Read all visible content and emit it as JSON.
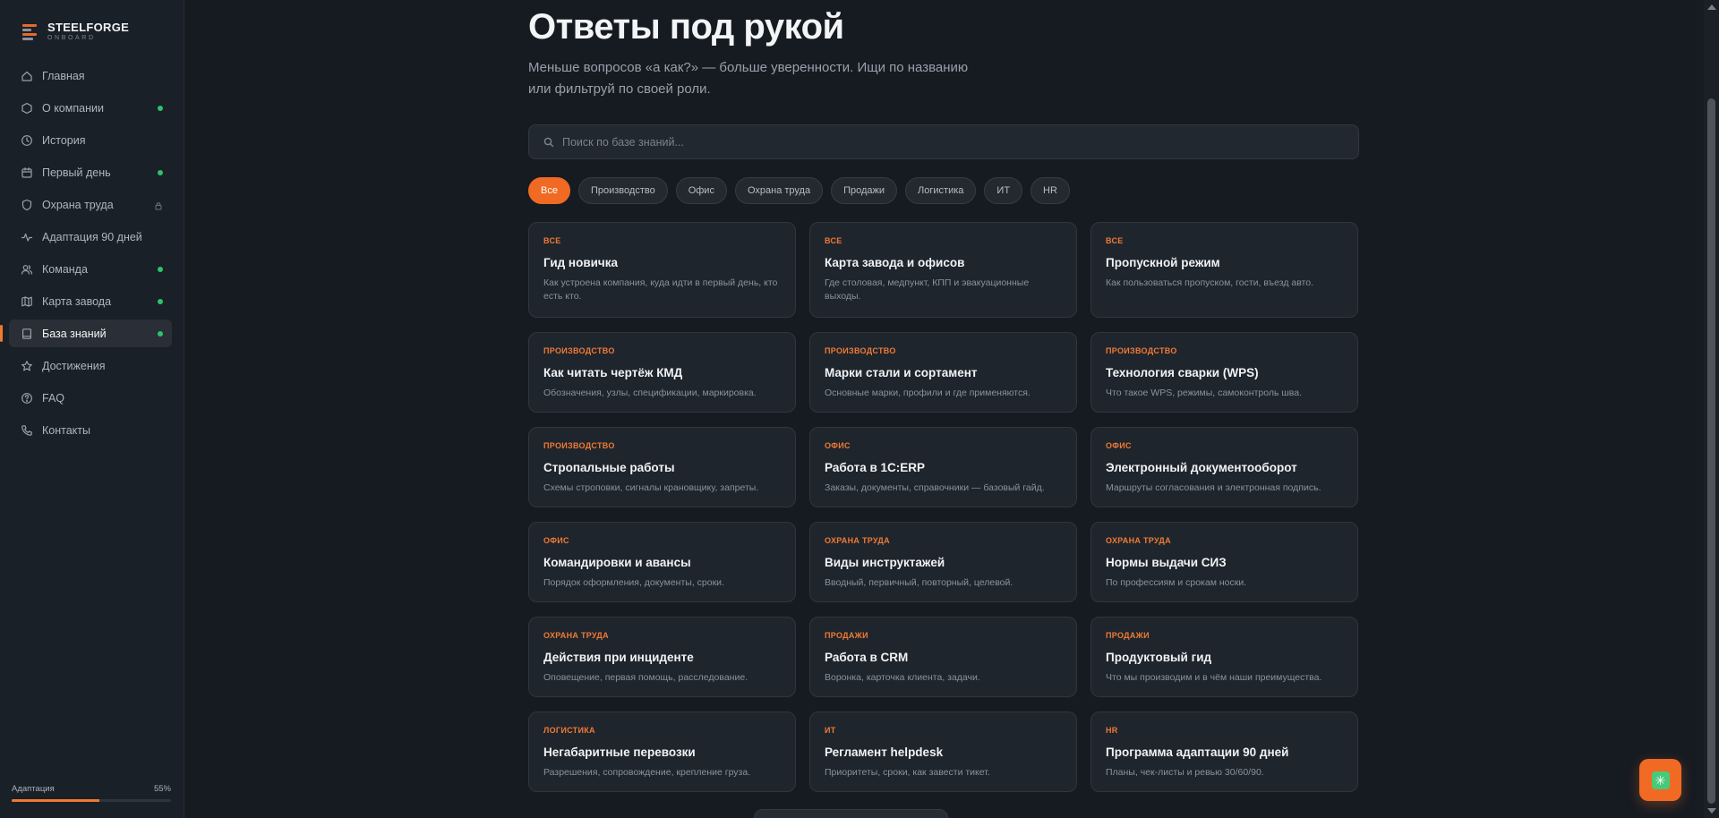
{
  "brand": {
    "name": "STEELFORGE",
    "tagline": "ONBOARD"
  },
  "sidebar": {
    "items": [
      {
        "label": "Главная",
        "icon": "home-icon",
        "indicator": "none"
      },
      {
        "label": "О компании",
        "icon": "hexagon-icon",
        "indicator": "dot"
      },
      {
        "label": "История",
        "icon": "clock-icon",
        "indicator": "none"
      },
      {
        "label": "Первый день",
        "icon": "calendar-icon",
        "indicator": "dot"
      },
      {
        "label": "Охрана труда",
        "icon": "shield-icon",
        "indicator": "lock"
      },
      {
        "label": "Адаптация 90 дней",
        "icon": "activity-icon",
        "indicator": "none"
      },
      {
        "label": "Команда",
        "icon": "users-icon",
        "indicator": "dot"
      },
      {
        "label": "Карта завода",
        "icon": "map-icon",
        "indicator": "dot"
      },
      {
        "label": "База знаний",
        "icon": "book-icon",
        "indicator": "dot",
        "active": true
      },
      {
        "label": "Достижения",
        "icon": "star-icon",
        "indicator": "none"
      },
      {
        "label": "FAQ",
        "icon": "help-circle-icon",
        "indicator": "none"
      },
      {
        "label": "Контакты",
        "icon": "phone-icon",
        "indicator": "none"
      }
    ],
    "progress": {
      "label": "Адаптация",
      "value_text": "55%",
      "fraction": 0.55
    }
  },
  "main": {
    "title": "Ответы под рукой",
    "subtitle": "Меньше вопросов «а как?» — больше уверенности. Ищи по названию или фильтруй по своей роли.",
    "search": {
      "placeholder": "Поиск по базе знаний...",
      "value": ""
    },
    "filters": [
      "Все",
      "Производство",
      "Офис",
      "Охрана труда",
      "Продажи",
      "Логистика",
      "ИТ",
      "HR"
    ],
    "active_filter": "Все",
    "cards": [
      {
        "category": "ВСЕ",
        "title": "Гид новичка",
        "description": "Как устроена компания, куда идти в первый день, кто есть кто."
      },
      {
        "category": "ВСЕ",
        "title": "Карта завода и офисов",
        "description": "Где столовая, медпункт, КПП и эвакуационные выходы."
      },
      {
        "category": "ВСЕ",
        "title": "Пропускной режим",
        "description": "Как пользоваться пропуском, гости, въезд авто."
      },
      {
        "category": "ПРОИЗВОДСТВО",
        "title": "Как читать чертёж КМД",
        "description": "Обозначения, узлы, спецификации, маркировка."
      },
      {
        "category": "ПРОИЗВОДСТВО",
        "title": "Марки стали и сортамент",
        "description": "Основные марки, профили и где применяются."
      },
      {
        "category": "ПРОИЗВОДСТВО",
        "title": "Технология сварки (WPS)",
        "description": "Что такое WPS, режимы, самоконтроль шва."
      },
      {
        "category": "ПРОИЗВОДСТВО",
        "title": "Стропальные работы",
        "description": "Схемы строповки, сигналы крановщику, запреты."
      },
      {
        "category": "ОФИС",
        "title": "Работа в 1С:ERP",
        "description": "Заказы, документы, справочники — базовый гайд."
      },
      {
        "category": "ОФИС",
        "title": "Электронный документооборот",
        "description": "Маршруты согласования и электронная подпись."
      },
      {
        "category": "ОФИС",
        "title": "Командировки и авансы",
        "description": "Порядок оформления, документы, сроки."
      },
      {
        "category": "ОХРАНА ТРУДА",
        "title": "Виды инструктажей",
        "description": "Вводный, первичный, повторный, целевой."
      },
      {
        "category": "ОХРАНА ТРУДА",
        "title": "Нормы выдачи СИЗ",
        "description": "По профессиям и срокам носки."
      },
      {
        "category": "ОХРАНА ТРУДА",
        "title": "Действия при инциденте",
        "description": "Оповещение, первая помощь, расследование."
      },
      {
        "category": "ПРОДАЖИ",
        "title": "Работа в CRM",
        "description": "Воронка, карточка клиента, задачи."
      },
      {
        "category": "ПРОДАЖИ",
        "title": "Продуктовый гид",
        "description": "Что мы производим и в чём наши преимущества."
      },
      {
        "category": "ЛОГИСТИКА",
        "title": "Негабаритные перевозки",
        "description": "Разрешения, сопровождение, крепление груза."
      },
      {
        "category": "ИТ",
        "title": "Регламент helpdesk",
        "description": "Приоритеты, сроки, как завести тикет."
      },
      {
        "category": "HR",
        "title": "Программа адаптации 90 дней",
        "description": "Планы, чек-листы и ревью 30/60/90."
      }
    ]
  },
  "fab": {
    "icon": "sparkle-icon"
  },
  "colors": {
    "accent": "#f06a23",
    "status_dot": "#2bc46a",
    "background": "#161b22",
    "card": "#1f252c"
  }
}
